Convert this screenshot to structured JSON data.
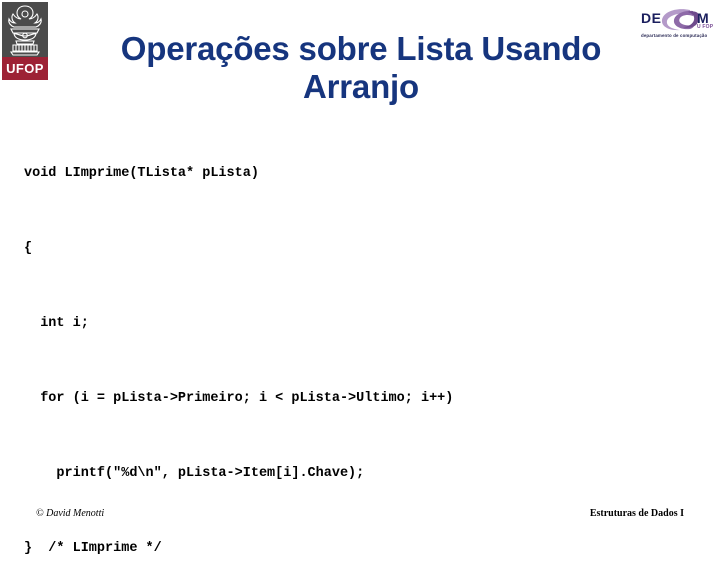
{
  "slide": {
    "title": "Operações sobre Lista Usando Arranjo",
    "background_color": "#ffffff",
    "title_color": "#16357e"
  },
  "ufop_logo": {
    "name": "ufop-logo",
    "wordmark": "UFOP",
    "crest_icon": "ufop-crest-icon",
    "crest_background": "#4b4b4b",
    "wordmark_background": "#9d2235",
    "wordmark_color": "#ffffff"
  },
  "decom_logo": {
    "name": "decom-logo",
    "text_left": "DE",
    "text_right": "M",
    "swoosh_icon": "decom-swoosh-icon",
    "sub_label": "U FOP",
    "tagline": "departamento de computação",
    "text_color": "#1b1f5e",
    "swoosh_color": "#9b7bb5"
  },
  "code": {
    "language": "c",
    "lines": [
      "void LImprime(TLista* pLista)",
      "{",
      "  int i;",
      "  for (i = pLista->Primeiro; i < pLista->Ultimo; i++)",
      "    printf(\"%d\\n\", pLista->Item[i].Chave);",
      "}  /* LImprime */"
    ]
  },
  "footer": {
    "left": "© David Menotti",
    "right": "Estruturas de Dados I"
  }
}
